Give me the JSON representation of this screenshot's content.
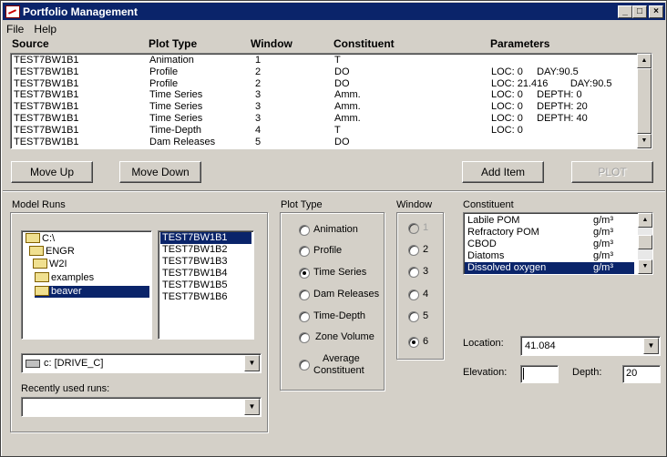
{
  "window": {
    "title": "Portfolio Management",
    "buttons": [
      "_",
      "□",
      "×"
    ]
  },
  "menu": [
    "File",
    "Help"
  ],
  "table": {
    "headers": {
      "source": "Source",
      "plot_type": "Plot Type",
      "window": "Window",
      "constituent": "Constituent",
      "parameters": "Parameters"
    },
    "rows": [
      {
        "source": "TEST7BW1B1",
        "plot_type": "Animation",
        "window": "1",
        "constituent": "T",
        "parameters": ""
      },
      {
        "source": "TEST7BW1B1",
        "plot_type": "Profile",
        "window": "2",
        "constituent": "DO",
        "parameters": "LOC: 0     DAY:90.5"
      },
      {
        "source": "TEST7BW1B1",
        "plot_type": "Profile",
        "window": "2",
        "constituent": "DO",
        "parameters": "LOC: 21.416        DAY:90.5"
      },
      {
        "source": "TEST7BW1B1",
        "plot_type": "Time Series",
        "window": "3",
        "constituent": "Amm.",
        "parameters": "LOC: 0     DEPTH: 0"
      },
      {
        "source": "TEST7BW1B1",
        "plot_type": "Time Series",
        "window": "3",
        "constituent": "Amm.",
        "parameters": "LOC: 0     DEPTH: 20"
      },
      {
        "source": "TEST7BW1B1",
        "plot_type": "Time Series",
        "window": "3",
        "constituent": "Amm.",
        "parameters": "LOC: 0     DEPTH: 40"
      },
      {
        "source": "TEST7BW1B1",
        "plot_type": "Time-Depth",
        "window": "4",
        "constituent": "T",
        "parameters": "LOC: 0"
      },
      {
        "source": "TEST7BW1B1",
        "plot_type": "Dam Releases",
        "window": "5",
        "constituent": "DO",
        "parameters": ""
      }
    ]
  },
  "buttons": {
    "move_up": "Move Up",
    "move_down": "Move Down",
    "add_item": "Add Item",
    "plot": "PLOT"
  },
  "model_runs": {
    "label": "Model Runs",
    "folders": [
      "C:\\",
      "ENGR",
      "W2I",
      "examples",
      "beaver"
    ],
    "selected_folder": "beaver",
    "files": [
      "TEST7BW1B1",
      "TEST7BW1B2",
      "TEST7BW1B3",
      "TEST7BW1B4",
      "TEST7BW1B5",
      "TEST7BW1B6"
    ],
    "selected_file": "TEST7BW1B1",
    "drive": "c: [DRIVE_C]",
    "recent_label": "Recently used runs:",
    "recent_value": ""
  },
  "plot_type": {
    "label": "Plot Type",
    "options": [
      "Animation",
      "Profile",
      "Time Series",
      "Dam Releases",
      "Time-Depth",
      "Zone Volume",
      "Average",
      "Constituent"
    ],
    "selected": "Time Series"
  },
  "window_group": {
    "label": "Window",
    "options": [
      "1",
      "2",
      "3",
      "4",
      "5",
      "6"
    ],
    "selected": "6",
    "disabled": [
      "1"
    ]
  },
  "constituent": {
    "label": "Constituent",
    "items": [
      {
        "name": "Labile POM",
        "unit": "g/m³"
      },
      {
        "name": "Refractory POM",
        "unit": "g/m³"
      },
      {
        "name": "CBOD",
        "unit": "g/m³"
      },
      {
        "name": "Diatoms",
        "unit": "g/m³"
      },
      {
        "name": "Dissolved oxygen",
        "unit": "g/m³"
      }
    ],
    "selected": "Dissolved oxygen"
  },
  "location": {
    "label": "Location:",
    "value": "41.084"
  },
  "elevation": {
    "label": "Elevation:",
    "value": ""
  },
  "depth": {
    "label": "Depth:",
    "value": "20"
  }
}
